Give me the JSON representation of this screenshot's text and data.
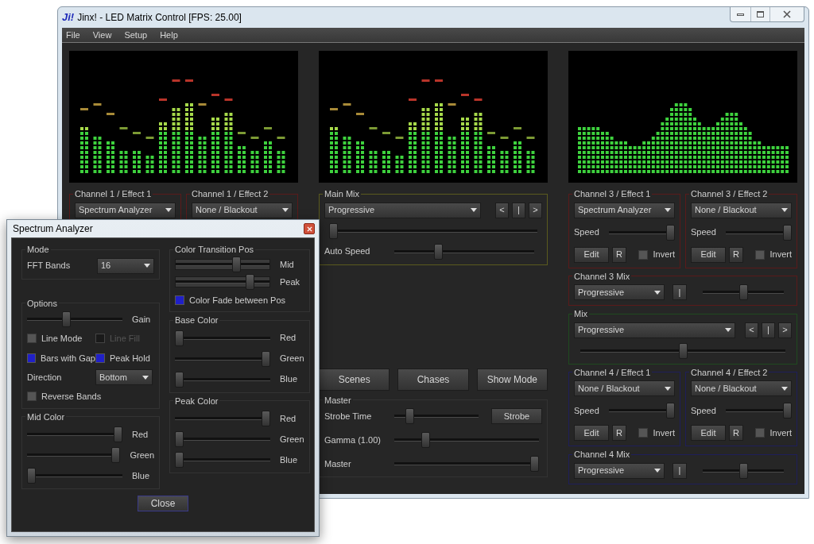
{
  "window": {
    "logo": "Ji!",
    "title": "Jinx! - LED Matrix Control [FPS: 25.00]"
  },
  "menu": [
    "File",
    "View",
    "Setup",
    "Help"
  ],
  "displays": [
    {
      "kind": "bars"
    },
    {
      "kind": "bars"
    },
    {
      "kind": "line"
    }
  ],
  "channel1_effects": [
    {
      "title": "Channel 1 / Effect 1",
      "effect": "Spectrum Analyzer"
    },
    {
      "title": "Channel 1 / Effect 2",
      "effect": "None / Blackout"
    }
  ],
  "main_mix": {
    "title": "Main Mix",
    "mode": "Progressive",
    "nav": [
      "<",
      "|",
      ">"
    ],
    "fader": {
      "level": 0.0
    },
    "auto_speed": {
      "label": "Auto Speed",
      "level": 0.3
    }
  },
  "mode_buttons": [
    "Scenes",
    "Chases",
    "Show Mode"
  ],
  "master": {
    "title": "Master",
    "rows": [
      {
        "label": "Strobe Time",
        "level": 0.15,
        "button": "Strobe"
      },
      {
        "label": "Gamma (1.00)",
        "level": 0.2
      },
      {
        "label": "Master",
        "level": 1.0
      }
    ]
  },
  "channel3_effects": [
    {
      "title": "Channel 3 / Effect 1",
      "effect": "Spectrum Analyzer",
      "speed_label": "Speed",
      "speed": {
        "level": 1.0
      },
      "edit": "Edit",
      "reset": "R",
      "invert_label": "Invert",
      "invert": false
    },
    {
      "title": "Channel 3 / Effect 2",
      "effect": "None / Blackout",
      "speed_label": "Speed",
      "speed": {
        "level": 1.0
      },
      "edit": "Edit",
      "reset": "R",
      "invert_label": "Invert",
      "invert": false
    }
  ],
  "channel3_mix": {
    "title": "Channel 3 Mix",
    "mode": "Progressive",
    "button": "|",
    "level": 0.5
  },
  "mix": {
    "title": "Mix",
    "mode": "Progressive",
    "nav": [
      "<",
      "|",
      ">"
    ],
    "level": 0.5
  },
  "channel4_effects": [
    {
      "title": "Channel 4 / Effect 1",
      "effect": "None / Blackout",
      "speed_label": "Speed",
      "speed": {
        "level": 1.0
      },
      "edit": "Edit",
      "reset": "R",
      "invert_label": "Invert",
      "invert": false
    },
    {
      "title": "Channel 4 / Effect 2",
      "effect": "None / Blackout",
      "speed_label": "Speed",
      "speed": {
        "level": 1.0
      },
      "edit": "Edit",
      "reset": "R",
      "invert_label": "Invert",
      "invert": false
    }
  ],
  "channel4_mix": {
    "title": "Channel 4 Mix",
    "mode": "Progressive",
    "button": "|",
    "level": 0.5
  },
  "dialog": {
    "title": "Spectrum Analyzer",
    "mode": {
      "title": "Mode",
      "fft_label": "FFT Bands",
      "fft_value": "16"
    },
    "options": {
      "title": "Options",
      "gain_label": "Gain",
      "gain": {
        "level": 0.4
      },
      "checks": [
        {
          "label": "Line Mode",
          "checked": false,
          "disabled": false
        },
        {
          "label": "Line Fill",
          "checked": false,
          "disabled": true
        },
        {
          "label": "Bars with Gap",
          "checked": true,
          "disabled": false
        },
        {
          "label": "Peak Hold",
          "checked": true,
          "disabled": false
        }
      ],
      "direction_label": "Direction",
      "direction": "Bottom",
      "reverse": {
        "label": "Reverse Bands",
        "checked": false,
        "disabled": false
      }
    },
    "transition": {
      "title": "Color Transition Pos",
      "sliders": [
        {
          "label": "Mid",
          "level": 0.66
        },
        {
          "label": "Peak",
          "level": 0.82
        }
      ],
      "fade": {
        "label": "Color Fade between Pos",
        "checked": true,
        "disabled": false
      }
    },
    "base_color": {
      "title": "Base Color",
      "sliders": [
        {
          "label": "Red",
          "level": 0.0
        },
        {
          "label": "Green",
          "level": 1.0
        },
        {
          "label": "Blue",
          "level": 0.0
        }
      ]
    },
    "mid_color": {
      "title": "Mid Color",
      "sliders": [
        {
          "label": "Red",
          "level": 1.0
        },
        {
          "label": "Green",
          "level": 1.0
        },
        {
          "label": "Blue",
          "level": 0.0
        }
      ]
    },
    "peak_color": {
      "title": "Peak Color",
      "sliders": [
        {
          "label": "Red",
          "level": 1.0
        },
        {
          "label": "Green",
          "level": 0.0
        },
        {
          "label": "Blue",
          "level": 0.0
        }
      ]
    },
    "close": "Close"
  }
}
